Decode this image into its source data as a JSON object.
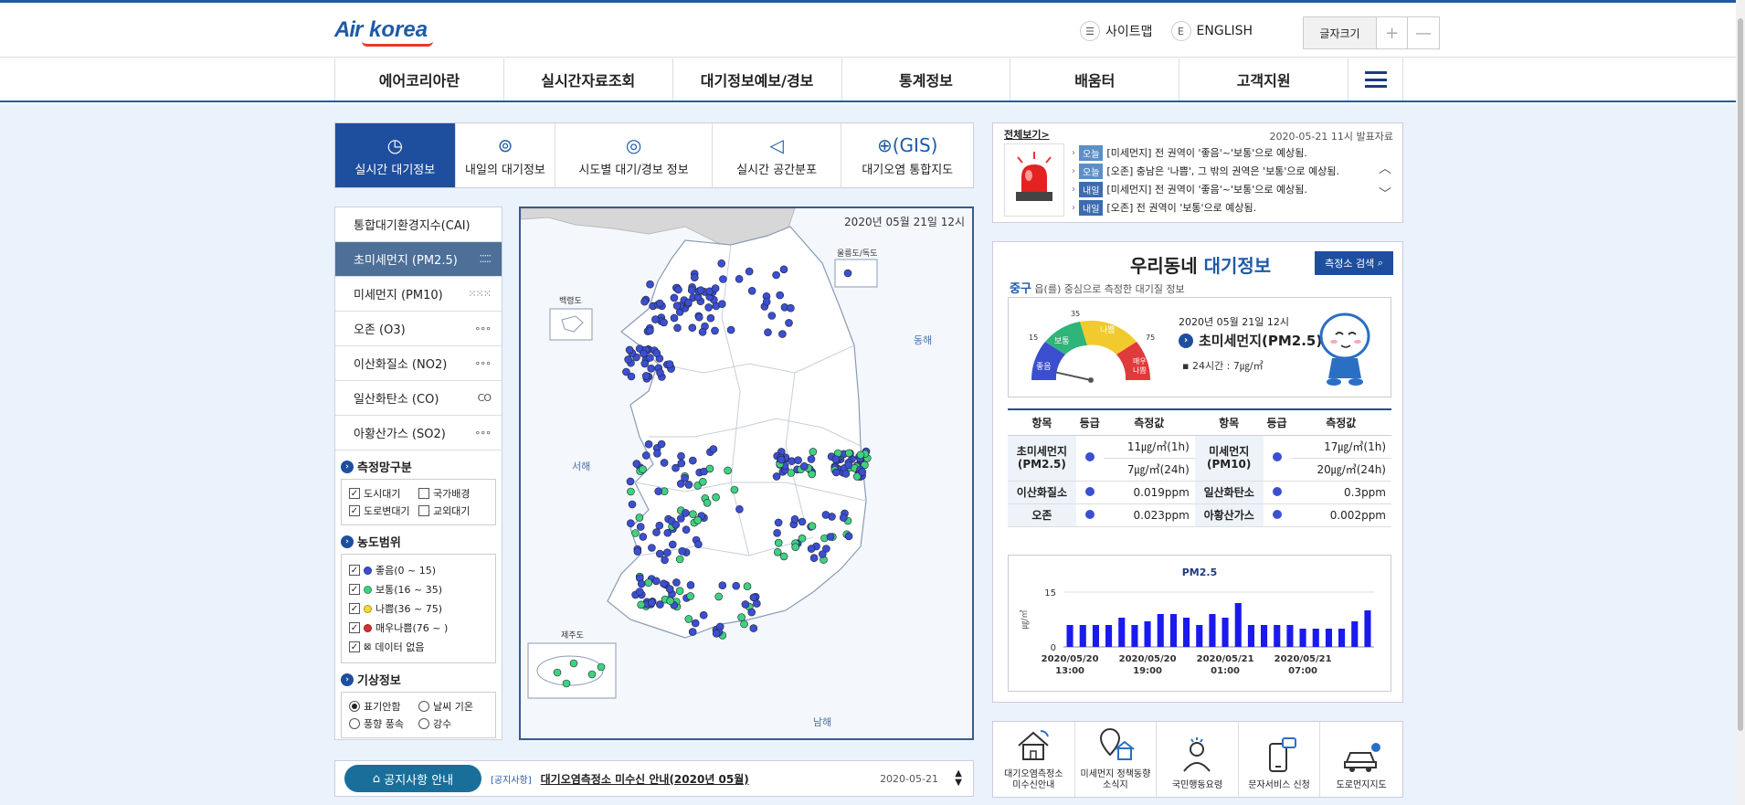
{
  "header": {
    "logo": "Air korea",
    "sitemap": "사이트맵",
    "english": "ENGLISH",
    "font_size_label": "글자크기",
    "font_plus": "+",
    "font_minus": "—"
  },
  "gnb": [
    "에어코리아란",
    "실시간자료조회",
    "대기정보예보/경보",
    "통계정보",
    "배움터",
    "고객지원"
  ],
  "tabs": [
    {
      "label": "실시간 대기정보",
      "icon": "clock-icon",
      "glyph": "◷",
      "width": 132
    },
    {
      "label": "내일의 대기정보",
      "icon": "location-icon",
      "glyph": "⊚",
      "width": 110
    },
    {
      "label": "시도별 대기/경보 정보",
      "icon": "compass-icon",
      "glyph": "◎",
      "width": 172
    },
    {
      "label": "실시간 공간분포",
      "icon": "megaphone-icon",
      "glyph": "◁",
      "width": 142
    },
    {
      "label": "대기오염 통합지도",
      "icon": "globe-icon",
      "glyph": "⊕(GIS)",
      "width": 144
    }
  ],
  "pollutants": [
    {
      "label": "통합대기환경지수(CAI)",
      "icon": "",
      "active": false
    },
    {
      "label": "초미세먼지 (PM2.5)",
      "icon": "⁚⁚⁚⁚⁚",
      "active": true
    },
    {
      "label": "미세먼지 (PM10)",
      "icon": "⁙⁙⁙",
      "active": false
    },
    {
      "label": "오존 (O3)",
      "icon": "∘∘∘",
      "active": false
    },
    {
      "label": "이산화질소 (NO2)",
      "icon": "∘∘∘",
      "active": false
    },
    {
      "label": "일산화탄소 (CO)",
      "icon": "CO",
      "active": false
    },
    {
      "label": "아황산가스 (SO2)",
      "icon": "∘∘∘",
      "active": false
    }
  ],
  "network": {
    "title": "측정망구분",
    "items": [
      {
        "label": "도시대기",
        "checked": true
      },
      {
        "label": "국가배경",
        "checked": false
      },
      {
        "label": "도로변대기",
        "checked": true
      },
      {
        "label": "교외대기",
        "checked": false
      }
    ]
  },
  "range": {
    "title": "농도범위",
    "items": [
      {
        "label": "좋음(0 ~ 15)",
        "color": "#3b4fd1"
      },
      {
        "label": "보통(16 ~ 35)",
        "color": "#3fd17f"
      },
      {
        "label": "나쁨(36 ~ 75)",
        "color": "#f3dc2a"
      },
      {
        "label": "매우나쁨(76 ~ )",
        "color": "#d93030"
      },
      {
        "label": "데이터 없음",
        "color": ""
      }
    ]
  },
  "weather": {
    "title": "기상정보",
    "items": [
      {
        "label": "표기안함",
        "on": true
      },
      {
        "label": "날씨 기온",
        "on": false
      },
      {
        "label": "풍향 풍속",
        "on": false
      },
      {
        "label": "강수",
        "on": false
      }
    ]
  },
  "map": {
    "date": "2020년 05월 21일 12시",
    "labels": {
      "west": "서해",
      "east": "동해",
      "south": "남해",
      "baengnyeong": "백령도",
      "ulleung": "울릉도/독도",
      "jeju": "제주도"
    }
  },
  "news": {
    "all": "전체보기>",
    "date": "2020-05-21 11시 발표자료",
    "items": [
      {
        "tag": "오늘",
        "text": "[미세먼지] 전 권역이 '좋음'~'보통'으로 예상됨."
      },
      {
        "tag": "오늘",
        "text": "[오존] 충남은 '나쁨', 그 밖의 권역은 '보통'으로 예상됨."
      },
      {
        "tag": "내일",
        "text": "[미세먼지] 전 권역이 '좋음'~'보통'으로 예상됨."
      },
      {
        "tag": "내일",
        "text": "[오존] 전 권역이 '보통'으로 예상됨."
      }
    ]
  },
  "air": {
    "title_a": "우리동네",
    "title_b": "대기정보",
    "search_btn": "측정소 검색",
    "gu": "중구",
    "sub": "읍(를) 중심으로 측정한 대기질 정보",
    "gauge_date": "2020년 05월 21일 12시",
    "gauge_name": "초미세먼지(PM2.5)",
    "gauge_24": "▪ 24시간 : 7㎍/㎥",
    "gauge_value": 7,
    "gauge_labels": {
      "good": "좋음",
      "normal": "보통",
      "bad": "나쁨",
      "vbad": "매우\n나쁨",
      "t15": "15",
      "t35": "35",
      "t75": "75"
    },
    "table_headers": [
      "항목",
      "등급",
      "측정값",
      "항목",
      "등급",
      "측정값"
    ],
    "rows": {
      "pm25_name": "초미세먼지\n(PM2.5)",
      "pm25_1h": "11㎍/㎥(1h)",
      "pm25_24h": "7㎍/㎥(24h)",
      "pm10_name": "미세먼지\n(PM10)",
      "pm10_1h": "17㎍/㎥(1h)",
      "pm10_24h": "20㎍/㎥(24h)",
      "no2_name": "이산화질소",
      "no2_val": "0.019ppm",
      "co_name": "일산화탄소",
      "co_val": "0.3ppm",
      "o3_name": "오존",
      "o3_val": "0.023ppm",
      "so2_name": "아황산가스",
      "so2_val": "0.002ppm"
    }
  },
  "chart_data": {
    "type": "bar",
    "title": "PM2.5",
    "ylabel": "㎍/㎥",
    "ylim": [
      0,
      15
    ],
    "yticks": [
      0,
      15
    ],
    "bar_color": "#1a1aee",
    "values": [
      6,
      6,
      6,
      6,
      8,
      6,
      7,
      9,
      9,
      8,
      6,
      9,
      8,
      12,
      6,
      6,
      6,
      6,
      5,
      5,
      5,
      5,
      7,
      10
    ],
    "xticks": [
      {
        "index": 0,
        "label": "2020/05/20\n13:00"
      },
      {
        "index": 6,
        "label": "2020/05/20\n19:00"
      },
      {
        "index": 12,
        "label": "2020/05/21\n01:00"
      },
      {
        "index": 18,
        "label": "2020/05/21\n07:00"
      }
    ]
  },
  "quick_links": [
    {
      "label": "대기오염측정소\n미수신안내",
      "icon": "house-signal-icon"
    },
    {
      "label": "미세먼지 정책동향\n소식지",
      "icon": "map-pin-house-icon"
    },
    {
      "label": "국민행동요령",
      "icon": "person-icon"
    },
    {
      "label": "문자서비스 신청",
      "icon": "phone-message-icon"
    },
    {
      "label": "도로먼지지도",
      "icon": "car-icon"
    }
  ],
  "notice": {
    "pill": "공지사항 안내",
    "tag": "[공지사항]",
    "title": "대기오염측정소 미수신 안내(2020년 05월)",
    "date": "2020-05-21"
  }
}
